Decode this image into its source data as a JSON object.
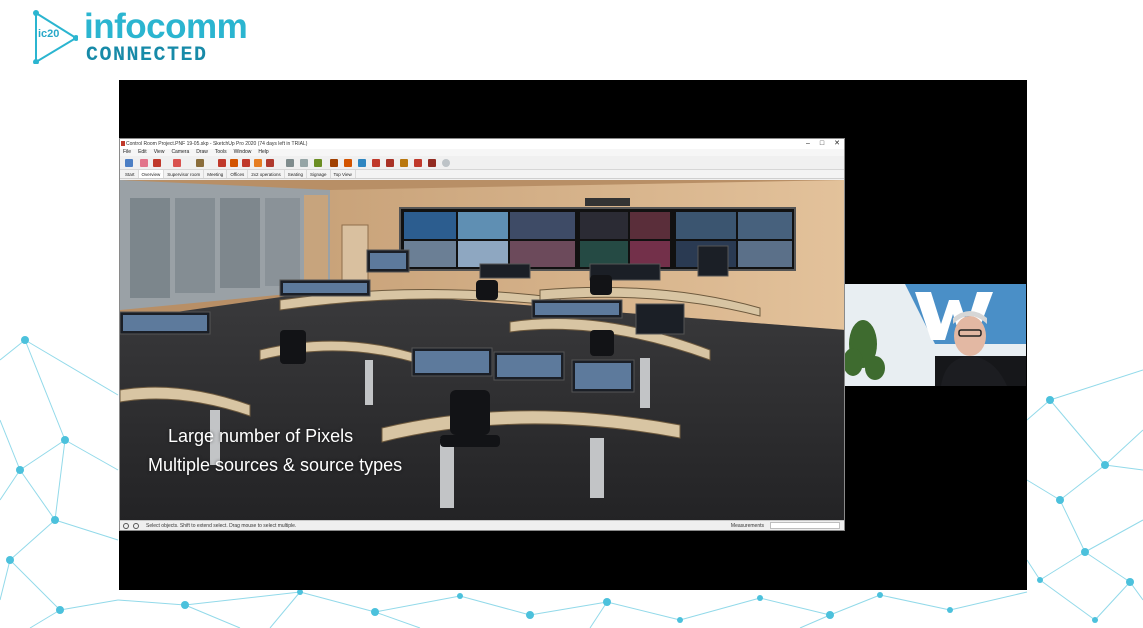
{
  "branding": {
    "badge": "ic20",
    "brand": "infocomm",
    "sub": "CONNECTED"
  },
  "sketchup": {
    "window_title": "Control Room Project.PNF 19-05.skp - SketchUp Pro 2020 (74 days left in TRIAL)",
    "window_controls": [
      "–",
      "□",
      "✕"
    ],
    "menu": [
      "File",
      "Edit",
      "View",
      "Camera",
      "Draw",
      "Tools",
      "Window",
      "Help"
    ],
    "scenes": [
      "Start",
      "Overview",
      "Supervisor room",
      "Meeting",
      "Offices",
      "2x2 operations",
      "Seating",
      "Signage",
      "Top View"
    ],
    "active_scene": 1,
    "status_text": "Select objects. Shift to extend select. Drag mouse to select multiple.",
    "measurements_label": "Measurements",
    "caption_line1": "Large number of Pixels",
    "caption_line2": "Multiple sources & source types"
  },
  "colors": {
    "accent_cyan": "#2bb5d0",
    "accent_dark": "#178aa8",
    "stage": "#000000"
  },
  "icons": [
    "sketchup-app-icon",
    "select-tool-icon",
    "eraser-icon",
    "pencil-icon",
    "shape-icon",
    "push-pull-icon",
    "move-icon",
    "rotate-icon",
    "tape-icon",
    "paint-icon",
    "orbit-icon",
    "pan-icon",
    "zoom-icon",
    "zoom-extents-icon",
    "warehouse-icon",
    "extension-icon",
    "instructor-icon",
    "geo-icon"
  ]
}
